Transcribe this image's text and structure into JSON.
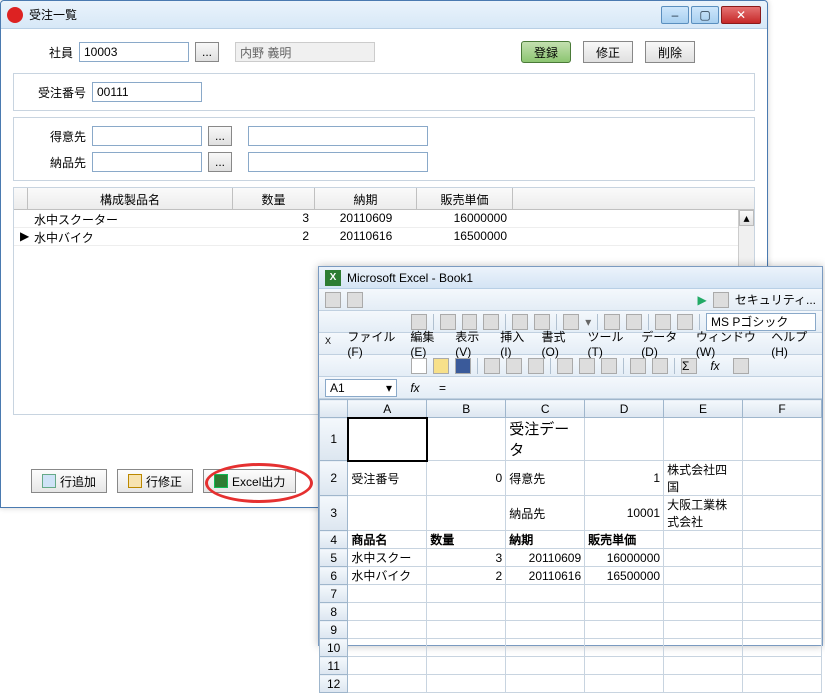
{
  "order_window": {
    "title": "受注一覧",
    "labels": {
      "employee": "社員",
      "order_no": "受注番号",
      "customer": "得意先",
      "shipto": "納品先"
    },
    "employee_id": "10003",
    "employee_name": "内野 義明",
    "order_no": "00111",
    "buttons": {
      "register": "登録",
      "edit": "修正",
      "delete": "削除",
      "lookup": "...",
      "add_row": "行追加",
      "edit_row": "行修正",
      "excel_out": "Excel出力"
    },
    "grid": {
      "headers": {
        "name": "構成製品名",
        "qty": "数量",
        "date": "納期",
        "price": "販売単価"
      },
      "rows": [
        {
          "name": "水中スクーター",
          "qty": "3",
          "date": "20110609",
          "price": "16000000"
        },
        {
          "name": "水中バイク",
          "qty": "2",
          "date": "20110616",
          "price": "16500000"
        }
      ]
    }
  },
  "excel": {
    "title": "Microsoft Excel - Book1",
    "security": "セキュリティ...",
    "font": "MS Pゴシック",
    "menu": [
      "ファイル(F)",
      "編集(E)",
      "表示(V)",
      "挿入(I)",
      "書式(O)",
      "ツール(T)",
      "データ(D)",
      "ウィンドウ(W)",
      "ヘルプ(H)"
    ],
    "name_box": "A1",
    "columns": [
      "A",
      "B",
      "C",
      "D",
      "E",
      "F"
    ],
    "rows": [
      "1",
      "2",
      "3",
      "4",
      "5",
      "6",
      "7",
      "8",
      "9",
      "10",
      "11",
      "12"
    ],
    "cells": {
      "C1": "受注データ",
      "A2": "受注番号",
      "B2": "0",
      "C2": "得意先",
      "D2": "1",
      "E2": "株式会社四国",
      "C3": "納品先",
      "D3": "10001",
      "E3": "大阪工業株式会社",
      "A4": "商品名",
      "B4": "数量",
      "C4": "納期",
      "D4": "販売単価",
      "A5": "水中スクー",
      "B5": "3",
      "C5": "20110609",
      "D5": "16000000",
      "A6": "水中バイク",
      "B6": "2",
      "C6": "20110616",
      "D6": "16500000"
    }
  },
  "chart_data": {
    "type": "table",
    "title": "受注データ",
    "order_no": 0,
    "customer": {
      "id": 1,
      "name": "株式会社四国"
    },
    "shipto": {
      "id": 10001,
      "name": "大阪工業株式会社"
    },
    "columns": [
      "商品名",
      "数量",
      "納期",
      "販売単価"
    ],
    "rows": [
      {
        "商品名": "水中スクーター",
        "数量": 3,
        "納期": "20110609",
        "販売単価": 16000000
      },
      {
        "商品名": "水中バイク",
        "数量": 2,
        "納期": "20110616",
        "販売単価": 16500000
      }
    ]
  }
}
